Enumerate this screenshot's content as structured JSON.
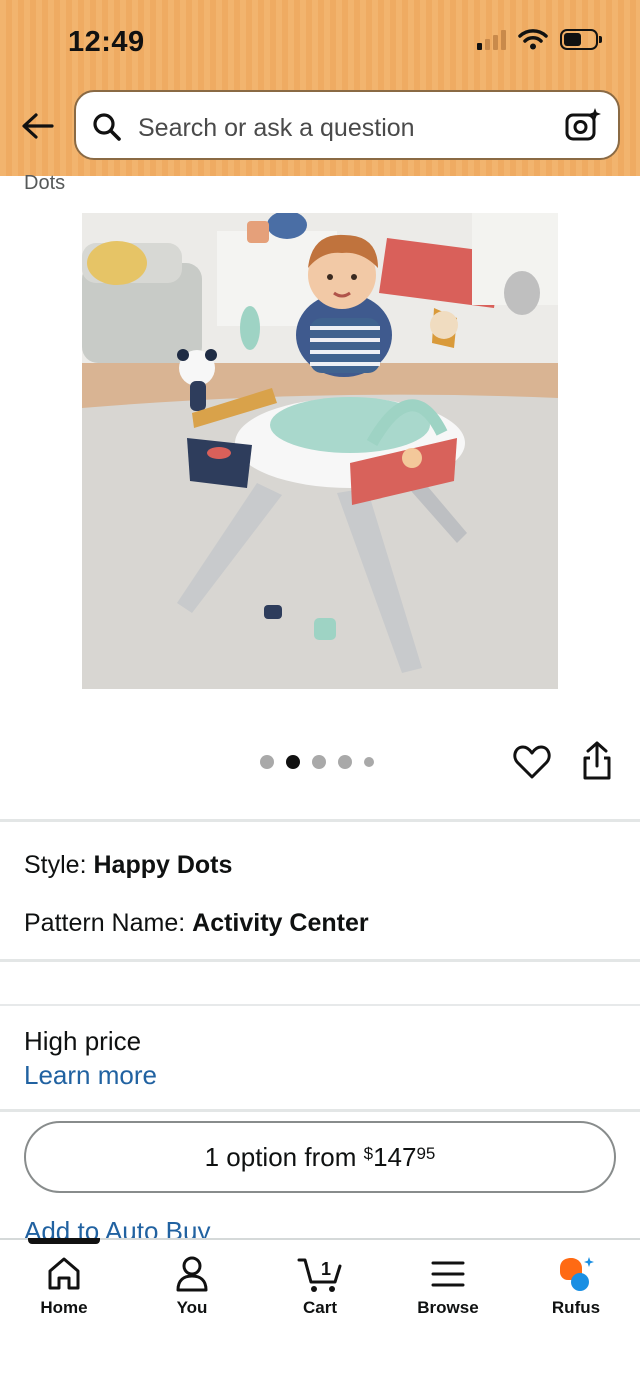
{
  "status_bar": {
    "time": "12:49"
  },
  "search": {
    "placeholder": "Search or ask a question"
  },
  "product": {
    "partial_title": "Dots",
    "carousel": {
      "count": 5,
      "active_index": 1
    }
  },
  "attributes": {
    "style_label": "Style:",
    "style_value": "Happy Dots",
    "pattern_label": "Pattern Name:",
    "pattern_value": "Activity Center"
  },
  "pricing": {
    "high_price": "High price",
    "learn_more": "Learn more",
    "option_prefix": "1 option from ",
    "currency": "$",
    "dollars": "147",
    "cents": "95"
  },
  "auto_buy": "Add to Auto Buy",
  "bottom_nav": {
    "home": "Home",
    "you": "You",
    "cart": "Cart",
    "cart_count": "1",
    "browse": "Browse",
    "rufus": "Rufus"
  },
  "colors": {
    "header_bg": "#f2b46e",
    "link": "#2162a1",
    "rufus_orange": "#ff6a13",
    "rufus_blue": "#1a8fe3"
  }
}
